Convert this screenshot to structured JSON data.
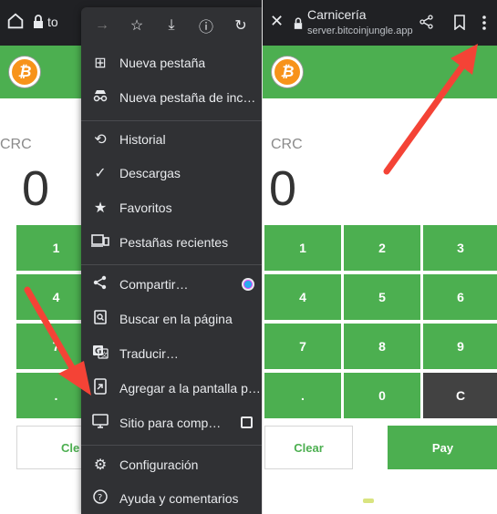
{
  "left_screen": {
    "address_partial": "to",
    "currency": "CRC",
    "amount": "0",
    "keypad": [
      "1",
      "4",
      "7",
      "."
    ],
    "clear_label": "Cle"
  },
  "chrome_menu": {
    "icon_row": [
      "forward-icon",
      "star-icon",
      "download-icon",
      "info-icon",
      "reload-icon"
    ],
    "items": [
      {
        "label": "Nueva pestaña",
        "icon": "new-tab-icon"
      },
      {
        "label": "Nueva pestaña de inc…",
        "icon": "incognito-icon"
      },
      {
        "label": "Historial",
        "icon": "history-icon"
      },
      {
        "label": "Descargas",
        "icon": "downloads-icon"
      },
      {
        "label": "Favoritos",
        "icon": "bookmarks-icon"
      },
      {
        "label": "Pestañas recientes",
        "icon": "recent-tabs-icon"
      },
      {
        "label": "Compartir…",
        "icon": "share-icon"
      },
      {
        "label": "Buscar en la página",
        "icon": "find-in-page-icon"
      },
      {
        "label": "Traducir…",
        "icon": "translate-icon"
      },
      {
        "label": "Agregar a la pantalla p…",
        "icon": "add-to-home-icon"
      },
      {
        "label": "Sitio para comp…",
        "icon": "desktop-site-icon"
      },
      {
        "label": "Configuración",
        "icon": "settings-icon"
      },
      {
        "label": "Ayuda y comentarios",
        "icon": "help-icon"
      }
    ]
  },
  "right_screen": {
    "tab_title": "Carnicería",
    "url": "server.bitcoinjungle.app",
    "currency": "CRC",
    "amount": "0",
    "keypad": [
      "1",
      "2",
      "3",
      "4",
      "5",
      "6",
      "7",
      "8",
      "9",
      ".",
      "0",
      "C"
    ],
    "clear_label": "Clear",
    "pay_label": "Pay"
  },
  "colors": {
    "accent_green": "#4caf50",
    "menu_bg": "#303134",
    "toolbar_bg": "#202124",
    "arrow_red": "#f44336"
  }
}
